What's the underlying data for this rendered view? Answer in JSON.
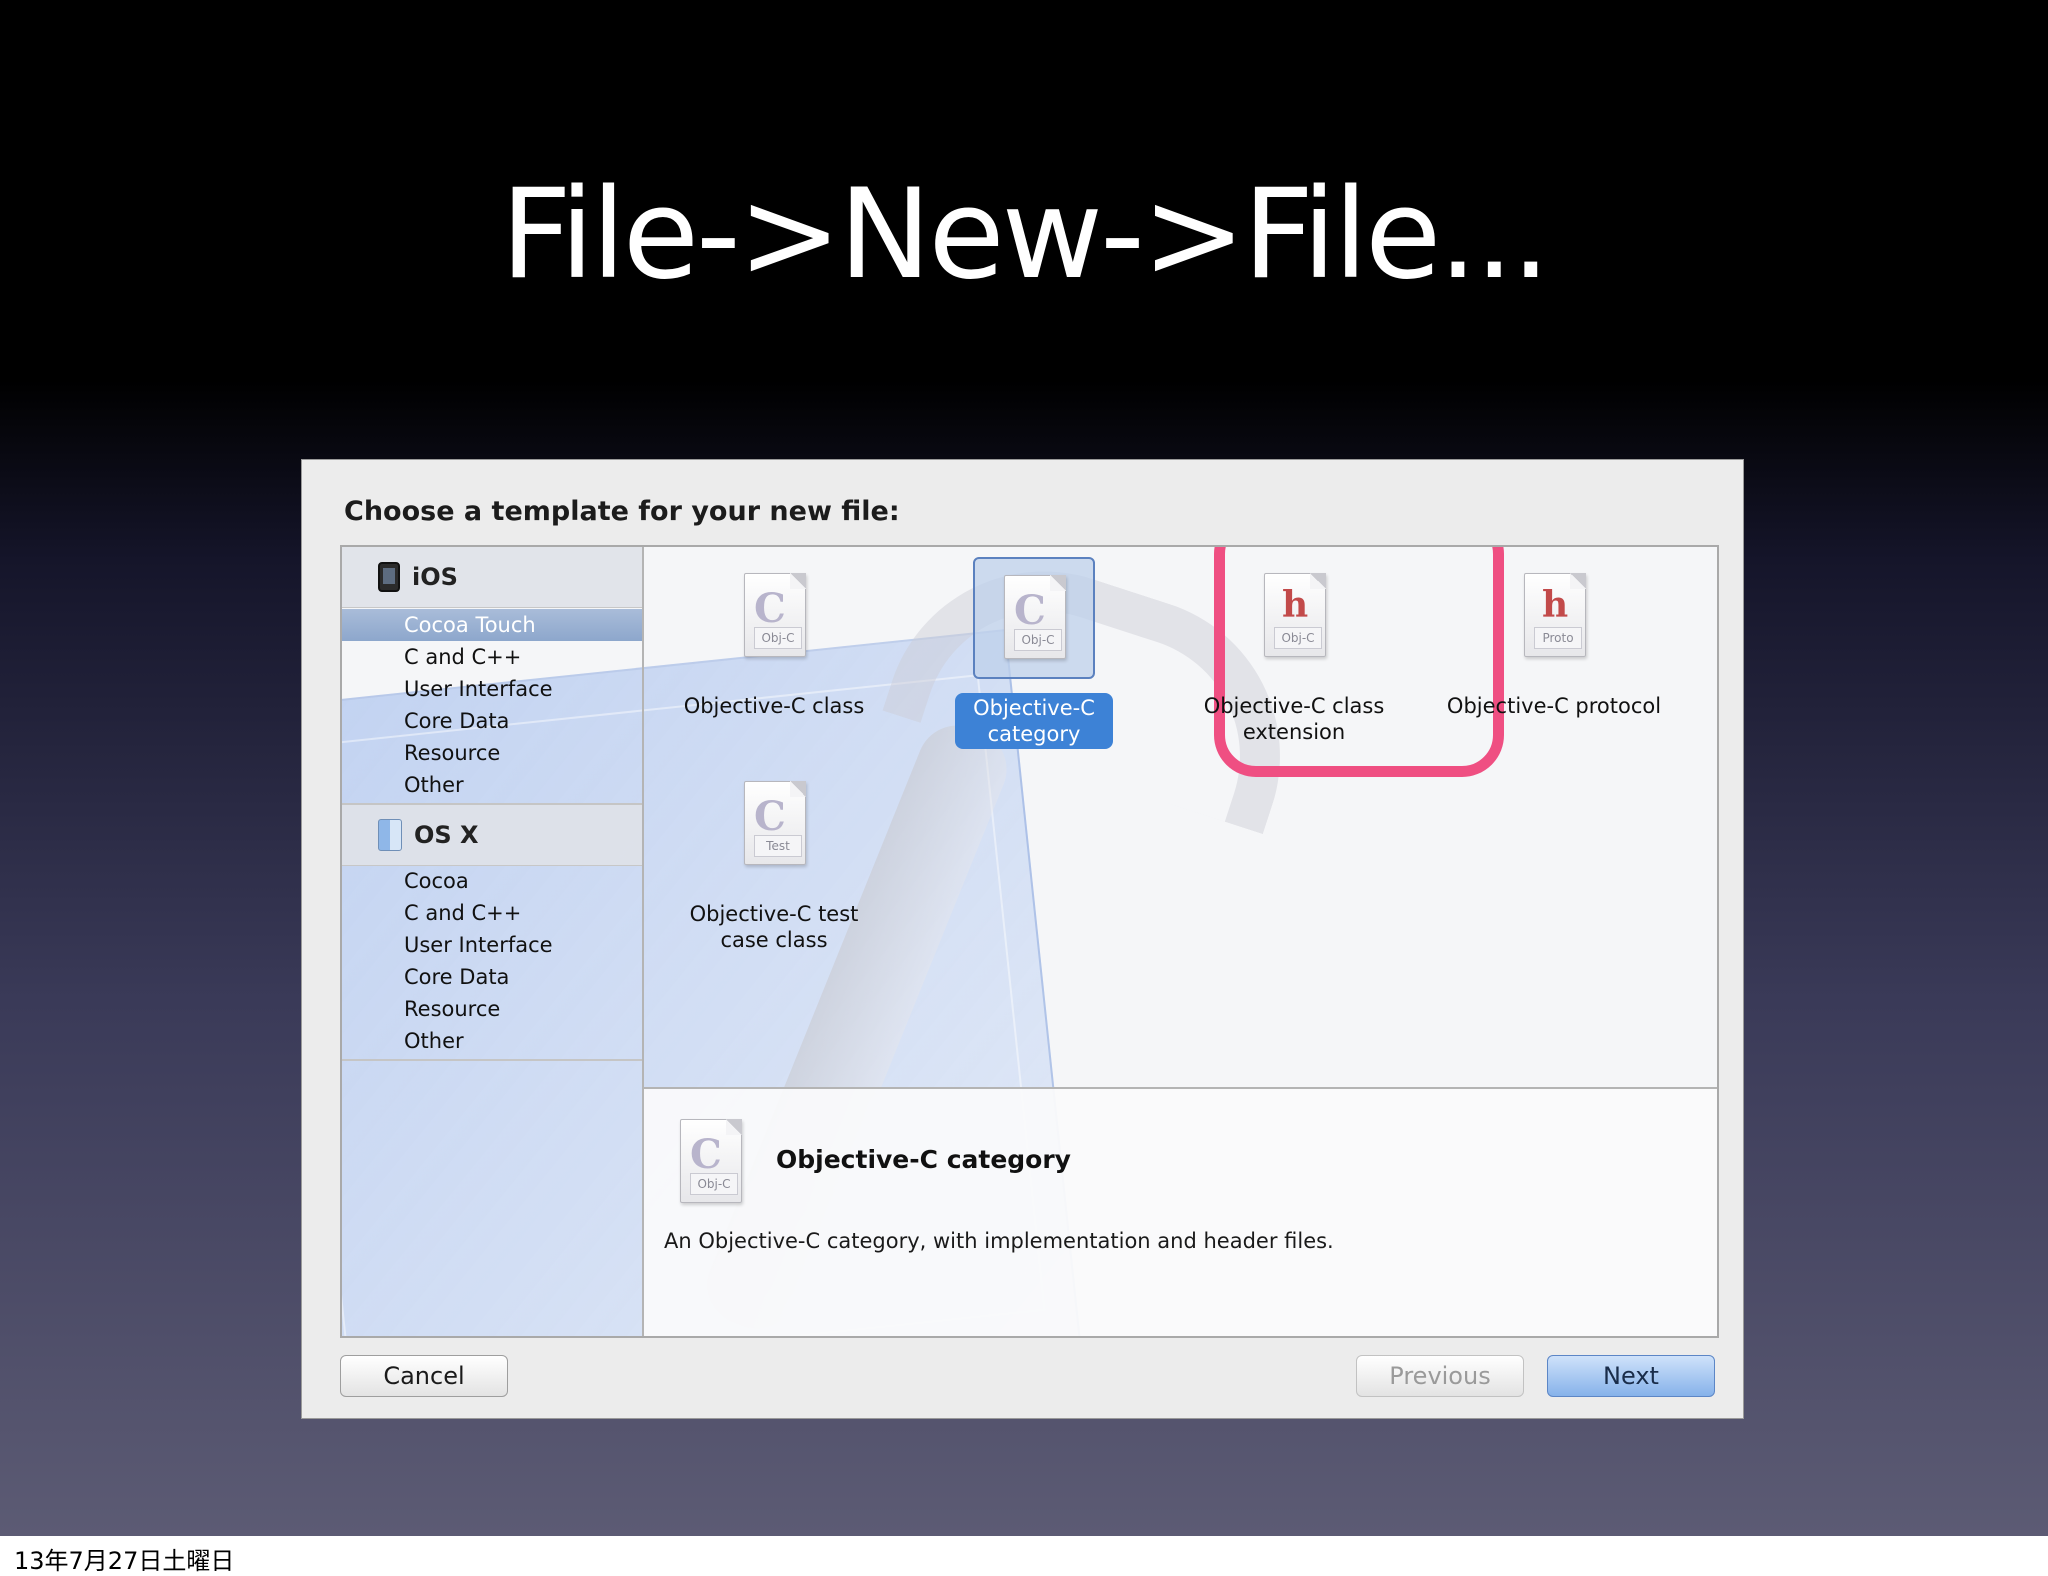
{
  "slide": {
    "title": "File->New->File...",
    "footer_date": "13年7月27日土曜日"
  },
  "dialog": {
    "prompt": "Choose a template for your new file:",
    "sidebar": {
      "groups": [
        {
          "label": "iOS",
          "icon": "iphone-icon",
          "items": [
            "Cocoa Touch",
            "C and C++",
            "User Interface",
            "Core Data",
            "Resource",
            "Other"
          ],
          "selected_item": "Cocoa Touch"
        },
        {
          "label": "OS X",
          "icon": "finder-icon",
          "items": [
            "Cocoa",
            "C and C++",
            "User Interface",
            "Core Data",
            "Resource",
            "Other"
          ]
        }
      ]
    },
    "templates": [
      {
        "label_lines": [
          "Objective-C class"
        ],
        "glyph": "C",
        "tag": "Obj-C"
      },
      {
        "label_lines": [
          "Objective-C",
          "category"
        ],
        "glyph": "C",
        "tag": "Obj-C",
        "selected": true
      },
      {
        "label_lines": [
          "Objective-C class",
          "extension"
        ],
        "glyph": "h",
        "tag": "Obj-C"
      },
      {
        "label_lines": [
          "Objective-C protocol"
        ],
        "glyph": "h",
        "tag": "Proto"
      },
      {
        "label_lines": [
          "Objective-C test",
          "case class"
        ],
        "glyph": "C",
        "tag": "Test"
      }
    ],
    "detail": {
      "title": "Objective-C category",
      "description": "An Objective-C category, with implementation and header files.",
      "icon_glyph": "C",
      "icon_tag": "Obj-C"
    },
    "buttons": {
      "cancel": "Cancel",
      "previous": "Previous",
      "next": "Next"
    }
  },
  "colors": {
    "highlight_ring": "#ef4f82",
    "selection_blue": "#3d82d6"
  }
}
